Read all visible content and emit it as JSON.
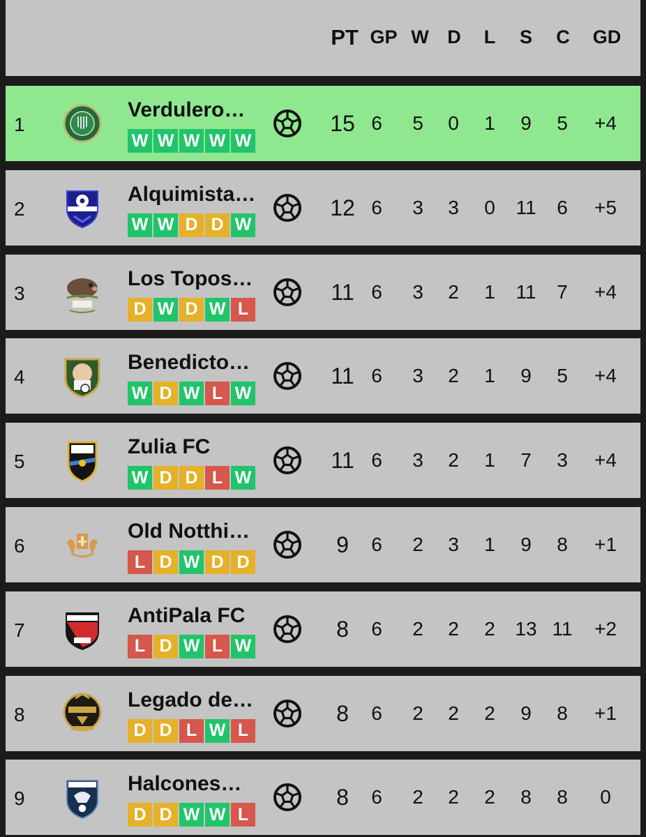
{
  "header": {
    "columns": [
      "PT",
      "GP",
      "W",
      "D",
      "L",
      "S",
      "C",
      "GD"
    ]
  },
  "colors": {
    "row_bg": "#c4c4c4",
    "leader_bg": "#8fe88f",
    "win": "#21c46a",
    "draw": "#e4b129",
    "loss": "#d6574b",
    "background": "#1b1b1b"
  },
  "rows": [
    {
      "pos": "1",
      "name": "Verdulero…",
      "form": [
        "W",
        "W",
        "W",
        "W",
        "W"
      ],
      "icon": "soccer-ball-icon",
      "pt": "15",
      "gp": "6",
      "w": "5",
      "d": "0",
      "l": "1",
      "s": "9",
      "c": "5",
      "gd": "+4"
    },
    {
      "pos": "2",
      "name": "Alquimista…",
      "form": [
        "W",
        "W",
        "D",
        "D",
        "W"
      ],
      "icon": "soccer-ball-icon",
      "pt": "12",
      "gp": "6",
      "w": "3",
      "d": "3",
      "l": "0",
      "s": "11",
      "c": "6",
      "gd": "+5"
    },
    {
      "pos": "3",
      "name": "Los Topos…",
      "form": [
        "D",
        "W",
        "D",
        "W",
        "L"
      ],
      "icon": "soccer-ball-icon",
      "pt": "11",
      "gp": "6",
      "w": "3",
      "d": "2",
      "l": "1",
      "s": "11",
      "c": "7",
      "gd": "+4"
    },
    {
      "pos": "4",
      "name": "Benedicto…",
      "form": [
        "W",
        "D",
        "W",
        "L",
        "W"
      ],
      "icon": "soccer-ball-icon",
      "pt": "11",
      "gp": "6",
      "w": "3",
      "d": "2",
      "l": "1",
      "s": "9",
      "c": "5",
      "gd": "+4"
    },
    {
      "pos": "5",
      "name": "Zulia FC",
      "form": [
        "W",
        "D",
        "D",
        "L",
        "W"
      ],
      "icon": "soccer-ball-icon",
      "pt": "11",
      "gp": "6",
      "w": "3",
      "d": "2",
      "l": "1",
      "s": "7",
      "c": "3",
      "gd": "+4"
    },
    {
      "pos": "6",
      "name": "Old Notthi…",
      "form": [
        "L",
        "D",
        "W",
        "D",
        "D"
      ],
      "icon": "soccer-ball-icon",
      "pt": "9",
      "gp": "6",
      "w": "2",
      "d": "3",
      "l": "1",
      "s": "9",
      "c": "8",
      "gd": "+1"
    },
    {
      "pos": "7",
      "name": "AntiPala FC",
      "form": [
        "L",
        "D",
        "W",
        "L",
        "W"
      ],
      "icon": "soccer-ball-icon",
      "pt": "8",
      "gp": "6",
      "w": "2",
      "d": "2",
      "l": "2",
      "s": "13",
      "c": "11",
      "gd": "+2"
    },
    {
      "pos": "8",
      "name": "Legado de…",
      "form": [
        "D",
        "D",
        "L",
        "W",
        "L"
      ],
      "icon": "soccer-ball-icon",
      "pt": "8",
      "gp": "6",
      "w": "2",
      "d": "2",
      "l": "2",
      "s": "9",
      "c": "8",
      "gd": "+1"
    },
    {
      "pos": "9",
      "name": "Halcones…",
      "form": [
        "D",
        "D",
        "W",
        "W",
        "L"
      ],
      "icon": "soccer-ball-icon",
      "pt": "8",
      "gp": "6",
      "w": "2",
      "d": "2",
      "l": "2",
      "s": "8",
      "c": "8",
      "gd": "0"
    }
  ]
}
